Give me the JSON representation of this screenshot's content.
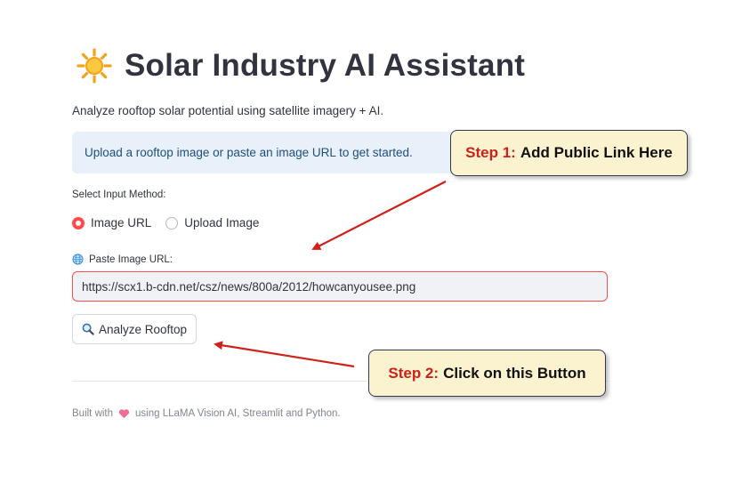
{
  "header": {
    "title": "Solar Industry AI Assistant",
    "subtitle": "Analyze rooftop solar potential using satellite imagery + AI.",
    "icon": "sun-icon"
  },
  "info": {
    "text": "Upload a rooftop image or paste an image URL to get started."
  },
  "input_method": {
    "label": "Select Input Method:",
    "options": [
      "Image URL",
      "Upload Image"
    ],
    "selected": "Image URL"
  },
  "url_field": {
    "label": "Paste Image URL:",
    "icon": "globe-icon",
    "value": "https://scx1.b-cdn.net/csz/news/800a/2012/howcanyousee.png"
  },
  "analyze_button": {
    "label": "Analyze Rooftop",
    "icon": "magnifier-icon"
  },
  "footer": {
    "prefix": "Built with",
    "suffix": "using LLaMA Vision AI, Streamlit and Python.",
    "icon": "heart-icon"
  },
  "annotations": {
    "step1_key": "Step 1:",
    "step1_text": "Add Public Link Here",
    "step2_key": "Step 2:",
    "step2_text": "Click on this Button"
  },
  "colors": {
    "accent": "#ff4b4b",
    "info_bg": "#e8f0f9",
    "info_text": "#1f4f7a",
    "callout_bg": "#fbf2d0",
    "arrow": "#d0201a"
  }
}
